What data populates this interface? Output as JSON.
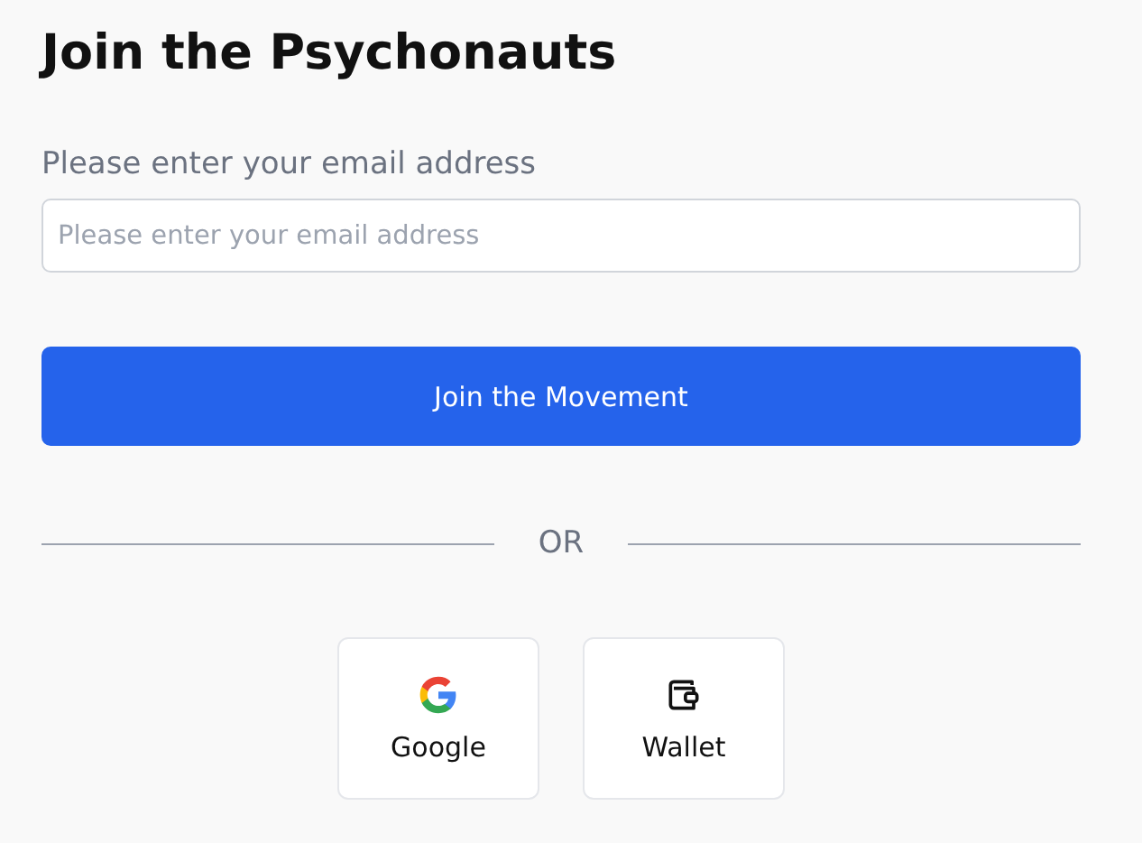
{
  "title": "Join the Psychonauts",
  "email": {
    "label": "Please enter your email address",
    "placeholder": "Please enter your email address"
  },
  "submit_button": "Join the Movement",
  "divider": "OR",
  "providers": [
    {
      "kind": "google",
      "label": "Google"
    },
    {
      "kind": "wallet",
      "label": "Wallet"
    }
  ]
}
